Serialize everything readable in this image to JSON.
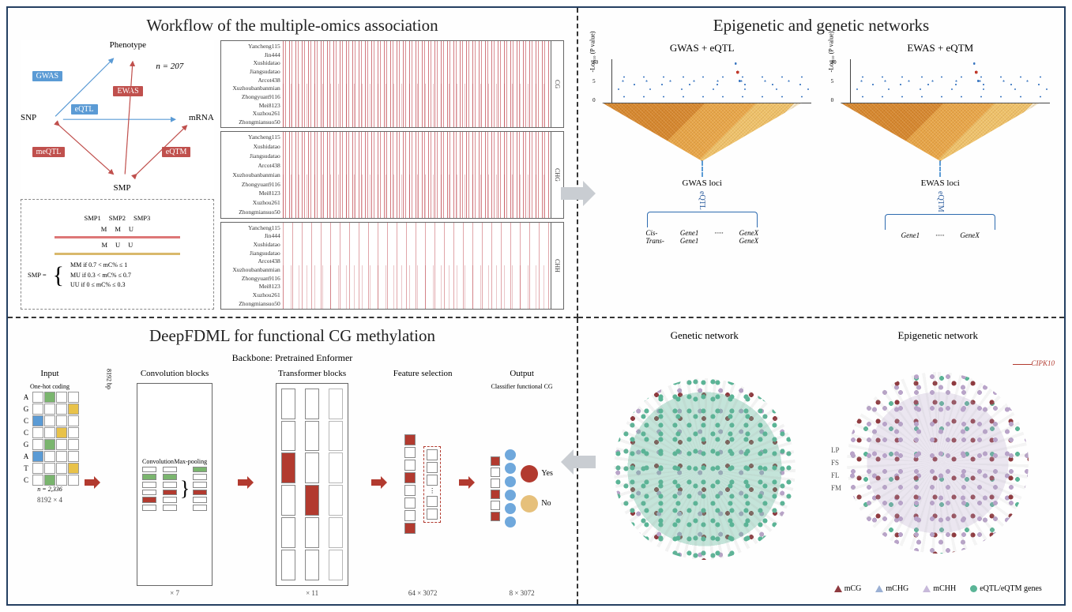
{
  "panels": {
    "tl_title": "Workflow of the multiple-omics association",
    "tr_title": "Epigenetic and genetic networks",
    "bl_title": "DeepFDML for functional CG methylation"
  },
  "workflow": {
    "phenotype": "Phenotype",
    "snp": "SNP",
    "mrna": "mRNA",
    "smp": "SMP",
    "n_label": "n = 207",
    "gwas": "GWAS",
    "eqtl": "eQTL",
    "ewas": "EWAS",
    "meqtl": "meQTL",
    "eqtm": "eQTM"
  },
  "smp_box": {
    "col_headers": [
      "SMP1",
      "SMP2",
      "SMP3"
    ],
    "row_m": [
      "M",
      "M",
      "U"
    ],
    "row_u": [
      "M",
      "U",
      "U"
    ],
    "label": "SMP =",
    "rule_mm": "MM   if 0.7 < mC% ≤ 1",
    "rule_mu": "MU   if 0.3 < mC% ≤ 0.7",
    "rule_uu": "UU   if  0   ≤ mC% ≤ 0.3"
  },
  "tracks": {
    "samples": [
      "Yancheng115",
      "Jin444",
      "Xushidatao",
      "Jiangsudatao",
      "Arcot438",
      "Xuzhoubanbanmian",
      "Zhongyuan9116",
      "Mei8123",
      "Xuzhou261",
      "Zhongmiansuo50"
    ],
    "contexts": [
      "CG",
      "CHG",
      "CHH"
    ]
  },
  "networks": {
    "left_title": "GWAS + eQTL",
    "right_title": "EWAS + eQTM",
    "y_label": "-Log₁₀ (P value)",
    "y_ticks": [
      "10",
      "5",
      "0"
    ],
    "left_loci": "GWAS loci",
    "right_loci": "EWAS loci",
    "left_method": "eQTL",
    "right_method": "eQTM",
    "left_cols": [
      "Cis-\nTrans-",
      "Gene1\nGene1",
      "",
      "GeneX\nGeneX"
    ],
    "right_cols": [
      "Gene1",
      "",
      "GeneX"
    ],
    "genetic_net": "Genetic network",
    "epigenetic_net": "Epigenetic network",
    "mid_labels": [
      "LP",
      "FS",
      "FL",
      "FM"
    ],
    "cipk10": "CIPK10",
    "legend": {
      "mcg": "mCG",
      "mchg": "mCHG",
      "mchh": "mCHH",
      "genes": "eQTL/eQTM genes"
    }
  },
  "deep": {
    "input": "Input",
    "backbone": "Backbone: Pretrained Enformer",
    "conv": "Convolution blocks",
    "conv_sub": {
      "a": "Convolution",
      "b": "Max-pooling"
    },
    "trans": "Transformer blocks",
    "feat": "Feature selection",
    "output": "Output",
    "onehot": "One-hot coding",
    "bases": [
      "A",
      "G",
      "C",
      "C",
      "G",
      "A",
      "T",
      "C"
    ],
    "n_samples": "n = 2,336",
    "seq_len": "8192 bp",
    "foot_input": "8192 × 4",
    "foot_conv": "× 7",
    "foot_trans": "× 11",
    "foot_feat": "64 × 3072",
    "foot_out": "8 × 3072",
    "classifier": "Classifier functional CG",
    "yes": "Yes",
    "no": "No"
  },
  "chart_data": [
    {
      "type": "scatter",
      "title": "GWAS + eQTL Manhattan",
      "ylabel": "-Log10(P value)",
      "ylim": [
        0,
        12
      ],
      "note": "decorative; peak cluster near 63% genomic position reaching ~11"
    },
    {
      "type": "scatter",
      "title": "EWAS + eQTM Manhattan",
      "ylabel": "-Log10(P value)",
      "ylim": [
        0,
        12
      ],
      "note": "decorative; peak cluster near 40% genomic position reaching ~11"
    }
  ]
}
